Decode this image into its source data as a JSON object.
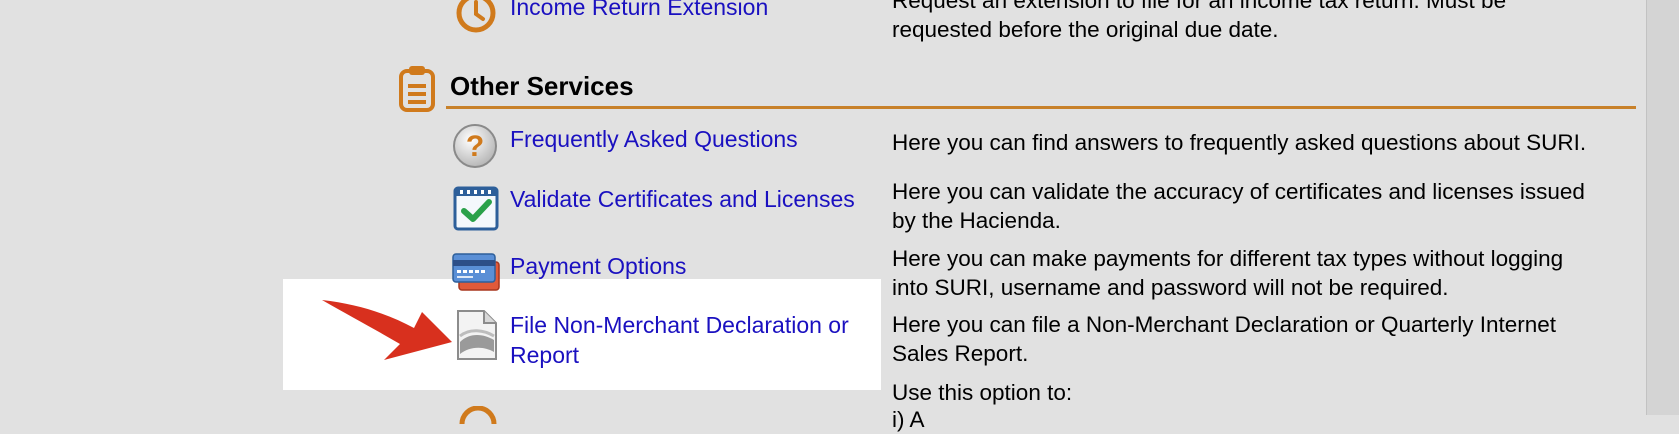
{
  "top_item": {
    "label": "Income Return Extension",
    "description": "Request an extension to file for an income tax return. Must be requested before the original due date."
  },
  "section": {
    "title": "Other Services",
    "accent_color": "#c8812a",
    "icon": "clipboard-icon"
  },
  "items": [
    {
      "label": "Frequently Asked Questions",
      "description": "Here you can find answers to frequently asked questions about SURI.",
      "icon": "question-icon"
    },
    {
      "label": "Validate Certificates and Licenses",
      "description": "Here you can validate the accuracy of certificates and licenses issued\nby the Hacienda.",
      "icon": "calendar-check-icon"
    },
    {
      "label": "Payment Options",
      "description": "Here you can make payments for different tax types without logging\ninto SURI, username and password will not be required.",
      "icon": "credit-card-icon"
    },
    {
      "label": "File Non-Merchant Declaration or\nReport",
      "description": "Here you can file a Non-Merchant Declaration or Quarterly Internet\nSales Report.",
      "icon": "document-icon"
    }
  ],
  "bottom_item": {
    "description_start": "Use this option to:",
    "description_partial": "i) A"
  }
}
